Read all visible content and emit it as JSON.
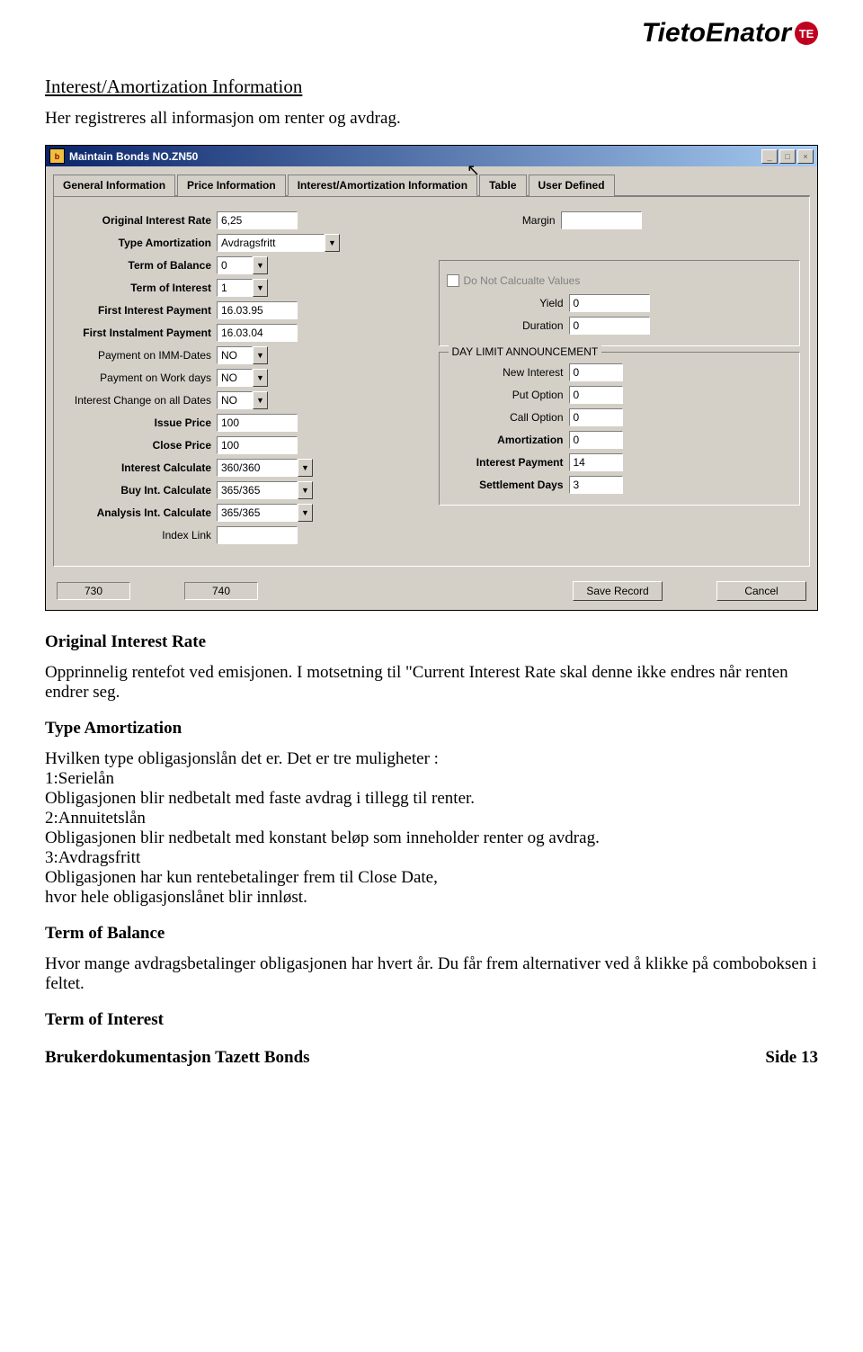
{
  "logo": {
    "text": "TietoEnator",
    "badge": "TE"
  },
  "heading": "Interest/Amortization Information",
  "intro": "Her registreres all informasjon om renter og avdrag.",
  "gui": {
    "title": "Maintain Bonds NO.ZN50",
    "tabs": [
      "General Information",
      "Price Information",
      "Interest/Amortization Information",
      "Table",
      "User Defined"
    ],
    "left": {
      "orig_rate_lbl": "Original Interest Rate",
      "orig_rate": "6,25",
      "type_amort_lbl": "Type Amortization",
      "type_amort": "Avdragsfritt",
      "term_bal_lbl": "Term of Balance",
      "term_bal": "0",
      "term_int_lbl": "Term of Interest",
      "term_int": "1",
      "first_int_lbl": "First Interest Payment",
      "first_int": "16.03.95",
      "first_inst_lbl": "First Instalment Payment",
      "first_inst": "16.03.04",
      "imm_lbl": "Payment on IMM-Dates",
      "imm": "NO",
      "work_lbl": "Payment on Work days",
      "work": "NO",
      "change_lbl": "Interest Change on all Dates",
      "change": "NO",
      "issue_lbl": "Issue Price",
      "issue": "100",
      "close_lbl": "Close Price",
      "close": "100",
      "intcalc_lbl": "Interest Calculate",
      "intcalc": "360/360",
      "buycalc_lbl": "Buy Int. Calculate",
      "buycalc": "365/365",
      "analysis_lbl": "Analysis Int. Calculate",
      "analysis": "365/365",
      "indexlink_lbl": "Index Link",
      "indexlink": ""
    },
    "right": {
      "margin_lbl": "Margin",
      "margin": "",
      "dnc_lbl": "Do Not Calcualte Values",
      "yield_lbl": "Yield",
      "yield": "0",
      "duration_lbl": "Duration",
      "duration": "0",
      "day_limit_legend": "DAY LIMIT ANNOUNCEMENT",
      "new_int_lbl": "New Interest",
      "new_int": "0",
      "put_lbl": "Put Option",
      "put": "0",
      "call_lbl": "Call Option",
      "call": "0",
      "amort_lbl": "Amortization",
      "amort": "0",
      "intpay_lbl": "Interest Payment",
      "intpay": "14",
      "settle_lbl": "Settlement Days",
      "settle": "3"
    },
    "btns": {
      "s1": "730",
      "s2": "740",
      "save": "Save Record",
      "cancel": "Cancel"
    }
  },
  "doc": {
    "oir_title": "Original Interest Rate",
    "oir_body": "Opprinnelig rentefot ved emisjonen. I motsetning til \"Current Interest Rate skal denne ikke endres når renten endrer seg.",
    "ta_title": "Type Amortization",
    "ta_body1": "Hvilken type obligasjonslån det er. Det er tre muligheter :",
    "ta_body2": "1:Serielån",
    "ta_body3": "Obligasjonen blir nedbetalt med faste avdrag i tillegg til renter.",
    "ta_body4": "2:Annuitetslån",
    "ta_body5": "Obligasjonen blir nedbetalt med konstant beløp som inneholder renter og avdrag.",
    "ta_body6": "3:Avdragsfritt",
    "ta_body7": "Obligasjonen har kun rentebetalinger frem til Close Date,",
    "ta_body8": "hvor hele obligasjonslånet blir innløst.",
    "tob_title": "Term of Balance",
    "tob_body": "Hvor mange avdragsbetalinger obligasjonen har hvert år. Du får frem alternativer ved å klikke på comboboksen i feltet.",
    "toi_title": "Term of Interest"
  },
  "footer": {
    "left": "Brukerdokumentasjon Tazett Bonds",
    "right": "Side 13"
  }
}
